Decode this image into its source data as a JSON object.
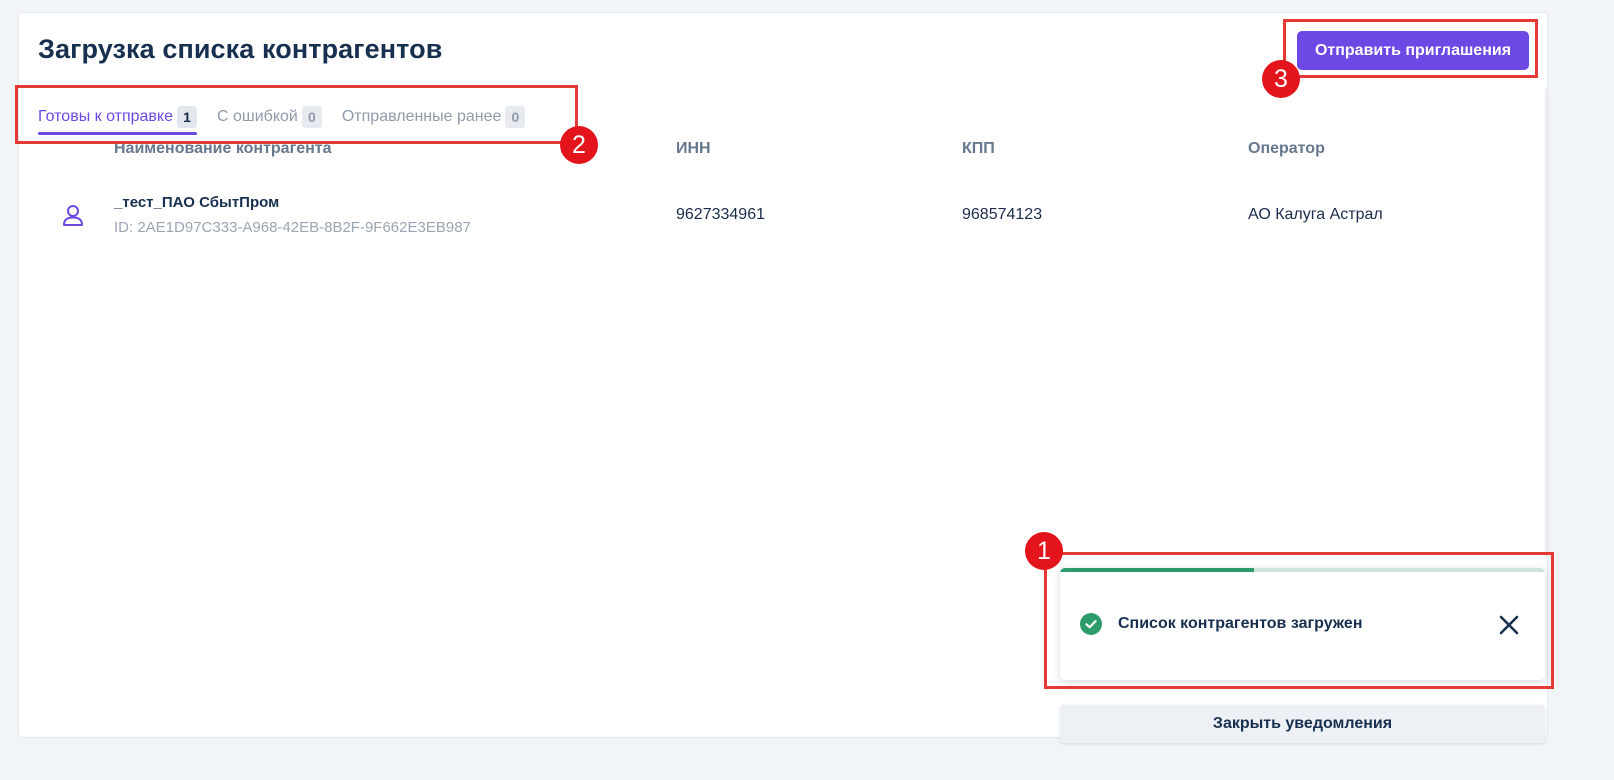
{
  "page": {
    "title": "Загрузка списка контрагентов",
    "send_button_label": "Отправить приглашения"
  },
  "tabs": [
    {
      "label": "Готовы к отправке",
      "count": "1",
      "active": true
    },
    {
      "label": "С ошибкой",
      "count": "0",
      "active": false
    },
    {
      "label": "Отправленные ранее",
      "count": "0",
      "active": false
    }
  ],
  "table": {
    "columns": [
      "Наименование контрагента",
      "ИНН",
      "КПП",
      "Оператор"
    ],
    "rows": [
      {
        "name": "_тест_ПАО СбытПром",
        "id": "ID: 2AE1D97C333-A968-42EB-8B2F-9F662E3EB987",
        "inn": "9627334961",
        "kpp": "968574123",
        "operator": "АО Калуга Астрал",
        "icon": "user-icon"
      }
    ]
  },
  "notification": {
    "text": "Список контрагентов загружен",
    "progress": 0.4,
    "icon": "check-circle-icon",
    "close_icon": "close-icon",
    "close_all_label": "Закрыть уведомления"
  },
  "annotations": [
    "1",
    "2",
    "3"
  ],
  "colors": {
    "accent": "#6c48e4",
    "success": "#2c9c6a",
    "annotation": "#e53936"
  }
}
